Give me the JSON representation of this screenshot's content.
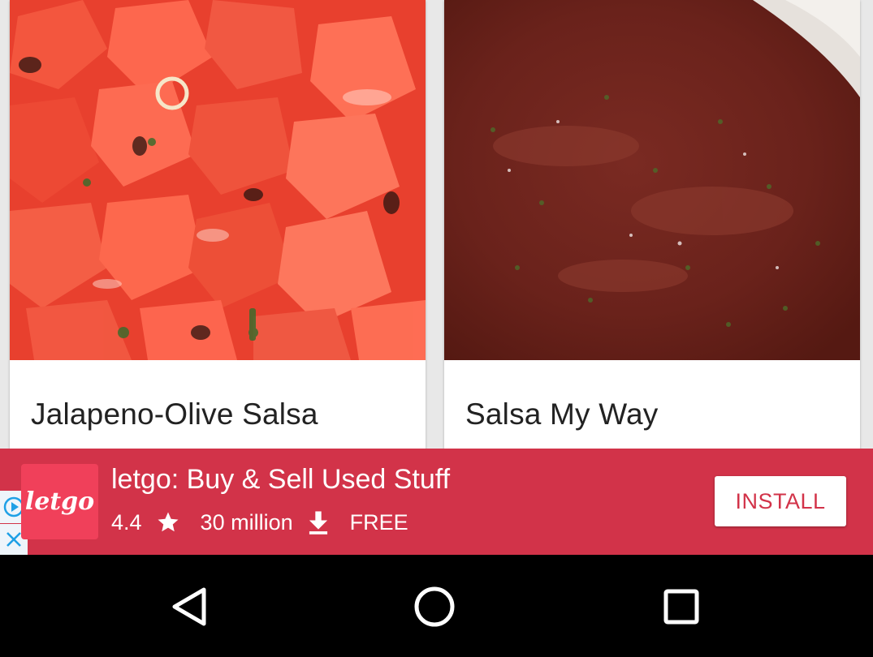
{
  "recipes": [
    {
      "title": "Jalapeno-Olive Salsa",
      "image": "chunky-tomato-salsa-photo"
    },
    {
      "title": "Salsa My Way",
      "image": "smooth-red-salsa-photo"
    }
  ],
  "ad": {
    "logo_text": "letgo",
    "app_name": "letgo: Buy & Sell Used Stuff",
    "rating": "4.4",
    "downloads": "30 million",
    "price": "FREE",
    "install_label": "INSTALL",
    "colors": {
      "banner": "#d23349",
      "logo": "#f0405a"
    }
  },
  "nav": {
    "icons": [
      "back-icon",
      "home-icon",
      "recents-icon"
    ]
  }
}
